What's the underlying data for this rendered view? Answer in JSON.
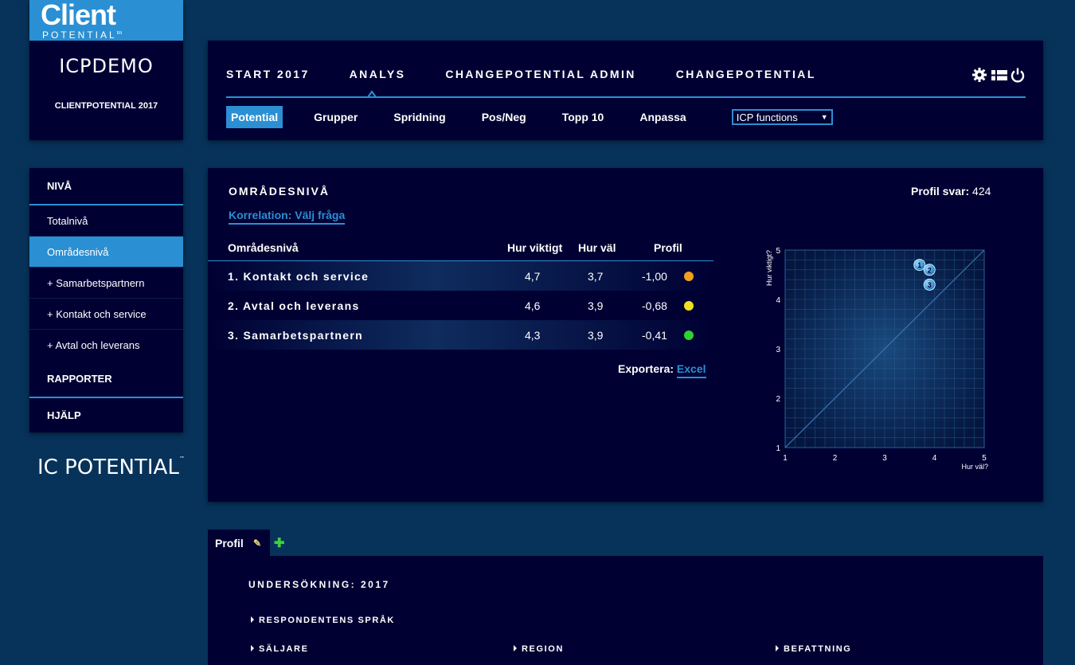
{
  "brand": {
    "logo_main": "Client",
    "logo_sub": "POTENTIAL",
    "logo_tm": "tm",
    "demo_label": "ICPDEMO",
    "year_label": "CLIENTPOTENTIAL 2017"
  },
  "main_nav": [
    {
      "label": "START 2017"
    },
    {
      "label": "ANALYS"
    },
    {
      "label": "CHANGEPOTENTIAL ADMIN"
    },
    {
      "label": "CHANGEPOTENTIAL"
    }
  ],
  "header_icons": [
    "gear-icon",
    "flag-icon",
    "power-icon"
  ],
  "sub_nav": [
    {
      "label": "Potential",
      "active": true
    },
    {
      "label": "Grupper"
    },
    {
      "label": "Spridning"
    },
    {
      "label": "Pos/Neg"
    },
    {
      "label": "Topp 10"
    },
    {
      "label": "Anpassa"
    }
  ],
  "select": {
    "value": "ICP functions"
  },
  "sidebar": {
    "items": [
      {
        "label": "NIVÅ"
      },
      {
        "label": "Totalnivå"
      },
      {
        "label": "Områdesnivå"
      },
      {
        "label": "+ Samarbetspartnern"
      },
      {
        "label": "+ Kontakt och service"
      },
      {
        "label": "+ Avtal och leverans"
      },
      {
        "label": "RAPPORTER"
      },
      {
        "label": "HJÄLP"
      }
    ],
    "footer_logo": "IC POTENTIAL"
  },
  "panel": {
    "title": "OMRÅDESNIVÅ",
    "profil_svar_label": "Profil svar:",
    "profil_svar_value": "424",
    "correlation_link": "Korrelation: Välj fråga",
    "columns": [
      "Områdesnivå",
      "Hur viktigt",
      "Hur väl",
      "Profil"
    ],
    "rows": [
      {
        "name": "1. Kontakt och service",
        "viktigt": "4,7",
        "val": "3,7",
        "profil": "-1,00",
        "color": "#f0a020"
      },
      {
        "name": "2. Avtal och leverans",
        "viktigt": "4,6",
        "val": "3,9",
        "profil": "-0,68",
        "color": "#f0e020"
      },
      {
        "name": "3. Samarbetspartnern",
        "viktigt": "4,3",
        "val": "3,9",
        "profil": "-0,41",
        "color": "#30d030"
      }
    ],
    "export_label": "Exportera:",
    "export_link": "Excel"
  },
  "chart_data": {
    "type": "scatter",
    "xlabel": "Hur väl?",
    "ylabel": "Hur viktigt?",
    "xlim": [
      1,
      5
    ],
    "ylim": [
      1,
      5
    ],
    "xticks": [
      "1",
      "2",
      "3",
      "4",
      "5"
    ],
    "yticks": [
      "1",
      "2",
      "3",
      "4",
      "5"
    ],
    "grid": true,
    "points": [
      {
        "label": "1",
        "x": 3.7,
        "y": 4.7
      },
      {
        "label": "2",
        "x": 3.9,
        "y": 4.6
      },
      {
        "label": "3",
        "x": 3.9,
        "y": 4.3
      }
    ]
  },
  "profile": {
    "tab_label": "Profil",
    "title": "UNDERSÖKNING: 2017",
    "items": [
      "RESPONDENTENS SPRÅK",
      "SÄLJARE",
      "REGION",
      "BEFATTNING"
    ]
  }
}
